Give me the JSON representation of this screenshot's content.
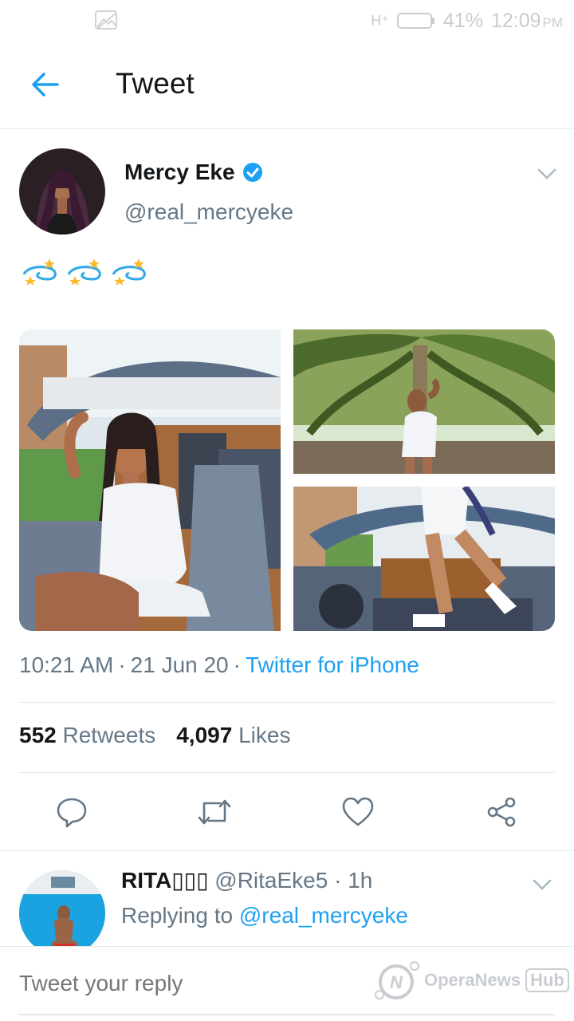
{
  "status_bar": {
    "network": "H⁺",
    "battery": "41%",
    "time": "12:09",
    "time_suffix": "PM"
  },
  "app_bar": {
    "title": "Tweet"
  },
  "tweet": {
    "author_name": "Mercy Eke",
    "author_handle": "@real_mercyeke",
    "text_emoji": [
      "💫",
      "💫",
      "💫"
    ],
    "time": "10:21 AM",
    "date": "21 Jun 20",
    "source": "Twitter for iPhone",
    "retweets_count": "552",
    "retweets_label": "Retweets",
    "likes_count": "4,097",
    "likes_label": "Likes"
  },
  "reply": {
    "name": "RITA",
    "handle": "@RitaEke5",
    "age": "1h",
    "replying_label": "Replying to",
    "replying_handle": "@real_mercyeke"
  },
  "composer": {
    "placeholder": "Tweet your reply"
  },
  "watermark": {
    "text": "OperaNews",
    "box": "Hub"
  },
  "colors": {
    "accent": "#1da1f2",
    "secondary_text": "#657786",
    "divider": "#e1e8ed"
  }
}
